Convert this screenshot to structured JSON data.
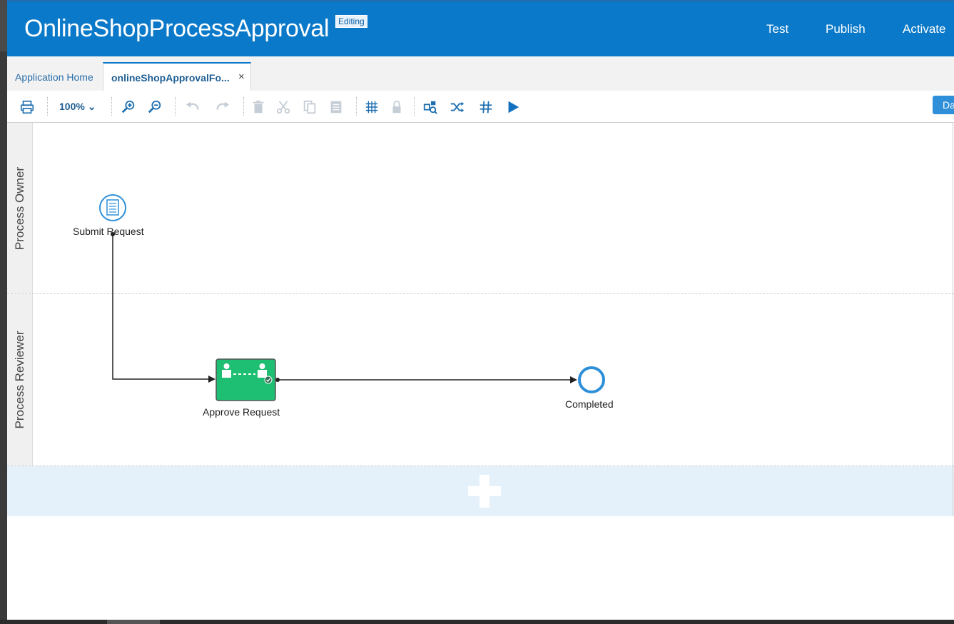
{
  "header": {
    "title": "OnlineShopProcessApproval",
    "status_badge": "Editing",
    "actions": {
      "test": "Test",
      "publish": "Publish",
      "activate": "Activate"
    }
  },
  "tabs": {
    "home": "Application Home",
    "active": "onlineShopApprovalFo...",
    "close": "×"
  },
  "toolbar": {
    "zoom": "100%",
    "right_button": "Da",
    "icons": [
      "print-icon",
      "zoom-dropdown",
      "zoom-in-icon",
      "zoom-out-icon",
      "undo-icon",
      "redo-icon",
      "delete-icon",
      "cut-icon",
      "copy-icon",
      "paste-icon",
      "grid-icon",
      "lock-icon",
      "validate-icon",
      "shuffle-icon",
      "hash-icon",
      "play-icon"
    ]
  },
  "lanes": [
    {
      "name": "Process Owner"
    },
    {
      "name": "Process Reviewer"
    }
  ],
  "nodes": {
    "start": {
      "label": "Submit Request",
      "type": "form-start-event"
    },
    "task": {
      "label": "Approve Request",
      "type": "approve-task",
      "color": "#1fbf73"
    },
    "end": {
      "label": "Completed",
      "type": "end-event",
      "color": "#2d8fd8"
    }
  },
  "colors": {
    "header": "#0a79c9",
    "accent": "#2f8fd8",
    "lane_add": "#e4f0fa"
  }
}
